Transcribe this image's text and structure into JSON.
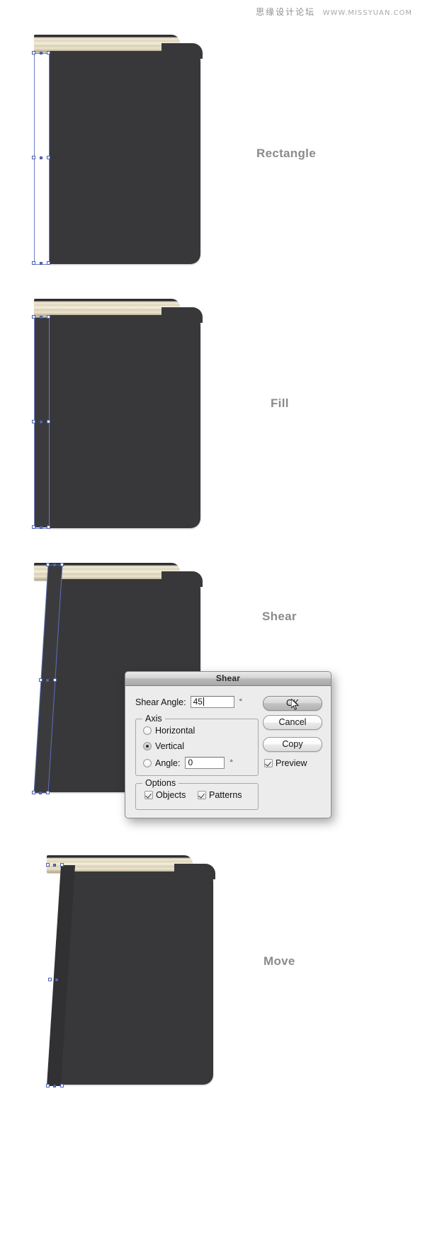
{
  "watermark": {
    "cn": "思缘设计论坛",
    "url": "WWW.MISSYUAN.COM"
  },
  "steps": [
    {
      "id": "rectangle",
      "label": "Rectangle"
    },
    {
      "id": "fill",
      "label": "Fill"
    },
    {
      "id": "shear",
      "label": "Shear"
    },
    {
      "id": "move",
      "label": "Move"
    }
  ],
  "dialog": {
    "title": "Shear",
    "angle_field": {
      "label": "Shear Angle:",
      "value": "45",
      "unit": "°"
    },
    "axis_group": {
      "title": "Axis",
      "options": [
        {
          "label": "Horizontal",
          "selected": false
        },
        {
          "label": "Vertical",
          "selected": true
        },
        {
          "label": "Angle:",
          "selected": false
        }
      ],
      "angle_value": "0",
      "angle_unit": "°"
    },
    "options_group": {
      "title": "Options",
      "checkboxes": [
        {
          "label": "Objects",
          "checked": true
        },
        {
          "label": "Patterns",
          "checked": true
        }
      ]
    },
    "buttons": [
      {
        "id": "ok",
        "label": "OK",
        "default": true
      },
      {
        "id": "cancel",
        "label": "Cancel",
        "default": false
      },
      {
        "id": "copy",
        "label": "Copy",
        "default": false
      }
    ],
    "preview": {
      "label": "Preview",
      "checked": true
    }
  },
  "colors": {
    "book_cover": "#38383a",
    "page_edge": "#e7e0cb",
    "selection_blue": "#6c7fc6",
    "label_gray": "#8b8b8b",
    "dialog_bg": "#ececec"
  },
  "icons": {
    "cursor": "arrow-cursor-icon",
    "radio": "radio-button-icon",
    "checkbox": "checkbox-icon"
  }
}
